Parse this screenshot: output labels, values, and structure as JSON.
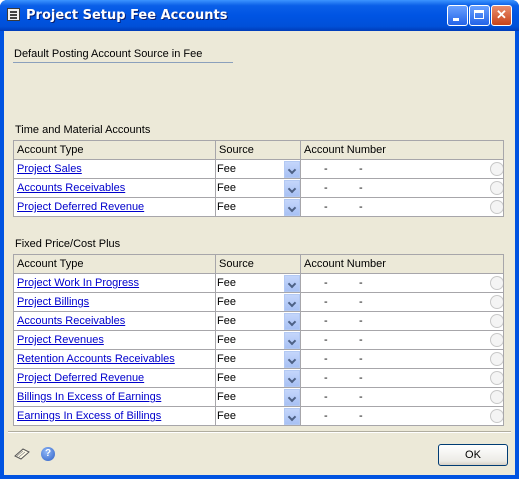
{
  "window": {
    "title": "Project Setup Fee Accounts"
  },
  "header": {
    "default_posting_label": "Default Posting Account Source in Fee"
  },
  "tm": {
    "section_label": "Time and Material Accounts",
    "columns": [
      "Account Type",
      "Source",
      "Account Number"
    ],
    "rows": [
      {
        "account_type": "Project Sales",
        "source": "Fee",
        "acct1": "-",
        "acct2": "-"
      },
      {
        "account_type": "Accounts Receivables",
        "source": "Fee",
        "acct1": "-",
        "acct2": "-"
      },
      {
        "account_type": "Project Deferred Revenue",
        "source": "Fee",
        "acct1": "-",
        "acct2": "-"
      }
    ]
  },
  "fp": {
    "section_label": "Fixed Price/Cost Plus",
    "columns": [
      "Account Type",
      "Source",
      "Account Number"
    ],
    "rows": [
      {
        "account_type": "Project Work In Progress",
        "source": "Fee",
        "acct1": "-",
        "acct2": "-"
      },
      {
        "account_type": "Project Billings",
        "source": "Fee",
        "acct1": "-",
        "acct2": "-"
      },
      {
        "account_type": "Accounts Receivables",
        "source": "Fee",
        "acct1": "-",
        "acct2": "-"
      },
      {
        "account_type": "Project Revenues",
        "source": "Fee",
        "acct1": "-",
        "acct2": "-"
      },
      {
        "account_type": "Retention Accounts Receivables",
        "source": "Fee",
        "acct1": "-",
        "acct2": "-"
      },
      {
        "account_type": "Project Deferred Revenue",
        "source": "Fee",
        "acct1": "-",
        "acct2": "-"
      },
      {
        "account_type": "Billings In Excess of Earnings",
        "source": "Fee",
        "acct1": "-",
        "acct2": "-"
      },
      {
        "account_type": "Earnings In Excess of Billings",
        "source": "Fee",
        "acct1": "-",
        "acct2": "-"
      }
    ]
  },
  "footer": {
    "ok_label": "OK",
    "help_glyph": "?"
  },
  "icons": {
    "window": "window-list-icon",
    "note": "note-icon",
    "help": "help-icon",
    "lookup": "lookup-icon",
    "dropdown": "chevron-down-icon"
  },
  "colors": {
    "titlebar": "#0054e3",
    "client": "#ece9d8",
    "link": "#0000cc"
  }
}
